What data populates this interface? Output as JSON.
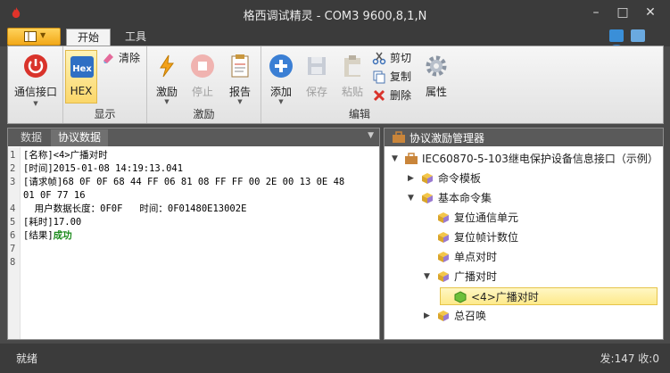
{
  "window": {
    "title": "格西调试精灵 - COM3  9600,8,1,N"
  },
  "tabs": {
    "home": "开始",
    "tools": "工具"
  },
  "ribbon": {
    "comm_port": "通信接口",
    "hex": "HEX",
    "clear": "清除",
    "display_group": "显示",
    "stimulus": "激励",
    "stop": "停止",
    "report": "报告",
    "stimulus_group": "激励",
    "add": "添加",
    "save": "保存",
    "paste": "粘贴",
    "cut": "剪切",
    "copy": "复制",
    "delete": "删除",
    "properties": "属性",
    "edit_group": "编辑"
  },
  "left_panel": {
    "tab_data": "数据",
    "tab_protocol": "协议数据",
    "lines": [
      {
        "n": "1",
        "t": "[名称]<4>广播对时"
      },
      {
        "n": "2",
        "t": "[时间]2015-01-08 14:19:13.041"
      },
      {
        "n": "3",
        "t": "[请求帧]68 0F 0F 68 44 FF 06 81 08 FF FF 00 2E 00 13 0E 48"
      },
      {
        "n": "",
        "t": "01 0F 77 16"
      },
      {
        "n": "4",
        "t": "  用户数据长度：0F0F   时间：0F01480E13002E"
      },
      {
        "n": "5",
        "t": "[耗时]17.00"
      },
      {
        "n": "6",
        "t": "[结果]",
        "ok": "成功"
      },
      {
        "n": "7",
        "t": ""
      },
      {
        "n": "8",
        "t": ""
      }
    ]
  },
  "right_panel": {
    "title": "协议激励管理器",
    "tree": [
      {
        "label": "IEC60870-5-103继电保护设备信息接口（示例）",
        "level": 0,
        "exp": "▼"
      },
      {
        "label": "命令模板",
        "level": 1,
        "exp": "▶"
      },
      {
        "label": "基本命令集",
        "level": 1,
        "exp": "▼"
      },
      {
        "label": "复位通信单元",
        "level": 2,
        "exp": ""
      },
      {
        "label": "复位帧计数位",
        "level": 2,
        "exp": ""
      },
      {
        "label": "单点对时",
        "level": 2,
        "exp": ""
      },
      {
        "label": "广播对时",
        "level": 2,
        "exp": "▼"
      },
      {
        "label": "<4>广播对时",
        "level": 3,
        "exp": "",
        "selected": true
      },
      {
        "label": "总召唤",
        "level": 2,
        "exp": "▶"
      }
    ]
  },
  "status": {
    "left": "就绪",
    "right": "发:147  收:0"
  },
  "colors": {
    "accent": "#f2a818",
    "success": "#1b8a1b",
    "titlebar": "#3b3b3b"
  }
}
